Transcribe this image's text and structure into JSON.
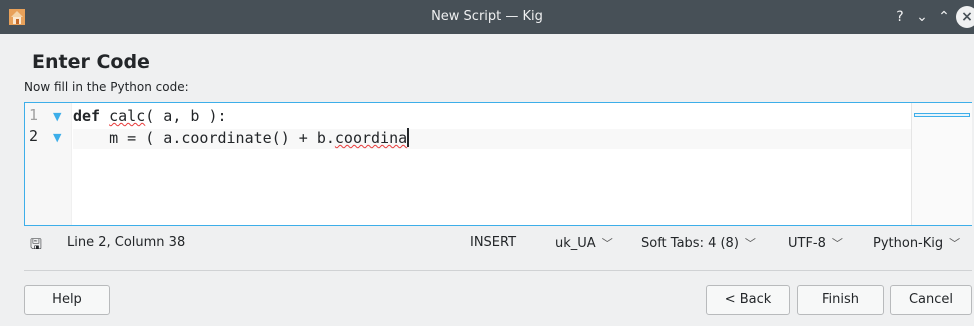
{
  "window": {
    "title": "New Script — Kig",
    "help_glyph": "?",
    "minimize_glyph": "⌄",
    "maximize_glyph": "⌃",
    "close_glyph": "×",
    "app_icon": "kig-house-icon"
  },
  "page": {
    "title": "Enter Code",
    "subtitle": "Now fill in the Python code:"
  },
  "editor": {
    "lines": [
      {
        "number": "1",
        "keyword": "def",
        "text_a": " ",
        "squiggly": "calc",
        "text_b": "( a, b ):"
      },
      {
        "number": "2",
        "keyword": "",
        "text_a": "    m = ( a.coordinate() + b.",
        "squiggly": "coordina",
        "text_b": ""
      }
    ]
  },
  "status": {
    "position": "Line 2, Column 38",
    "mode": "INSERT",
    "dictionary": "uk_UA",
    "indent": "Soft Tabs: 4 (8)",
    "encoding": "UTF-8",
    "highlighting": "Python-Kig",
    "save_icon": "save-icon"
  },
  "buttons": {
    "help": "Help",
    "back": "< Back",
    "finish": "Finish",
    "cancel": "Cancel"
  },
  "colors": {
    "titlebar": "#475057",
    "accent": "#3daee9",
    "background": "#eff0f1",
    "spellcheck": "#e83a3a"
  }
}
